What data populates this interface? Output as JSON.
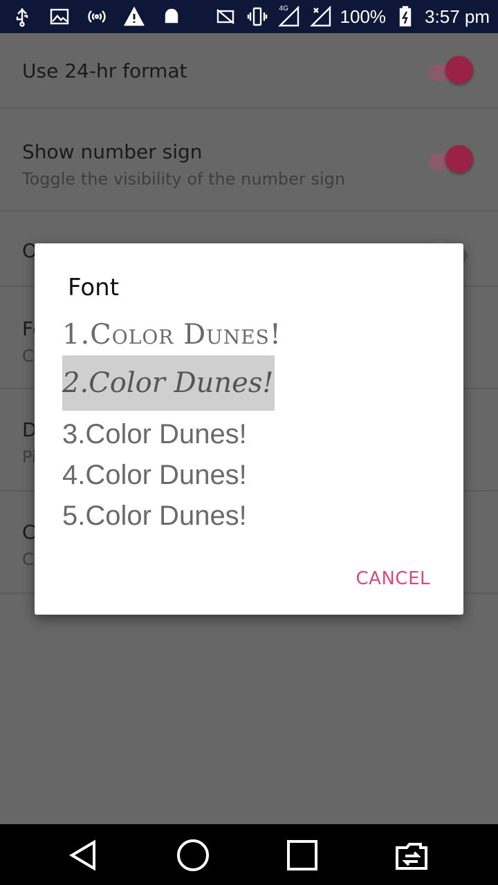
{
  "status_bar": {
    "left_icons": [
      "usb-icon",
      "image-icon",
      "hotspot-icon",
      "warning-icon",
      "android-icon"
    ],
    "right_icons": [
      "no-sim-icon",
      "vibrate-icon",
      "signal-4g-icon",
      "signal-2-icon"
    ],
    "network_label": "4G",
    "battery_percent": "100%",
    "time": "3:57 pm"
  },
  "settings": {
    "rows": [
      {
        "title": "Use 24-hr format",
        "enabled": true
      },
      {
        "title": "Show number sign",
        "subtitle": "Toggle the visibility of the number sign",
        "enabled": true
      },
      {
        "title": "O",
        "enabled": false
      },
      {
        "title": "Fo",
        "subtitle": "C"
      },
      {
        "title": "D",
        "subtitle": "Pi"
      },
      {
        "title": "C",
        "subtitle": "C"
      }
    ]
  },
  "dialog": {
    "title": "Font",
    "options": [
      "1.Color Dunes!",
      "2.Color Dunes!",
      "3.Color Dunes!",
      "4.Color Dunes!",
      "5.Color Dunes!"
    ],
    "selected_index": 1,
    "cancel_label": "CANCEL"
  },
  "nav_bar": {
    "buttons": [
      "back-icon",
      "home-icon",
      "recents-icon",
      "switch-app-icon"
    ]
  },
  "colors": {
    "accent": "#e0467a",
    "toggle_on": "#9a2249",
    "status_bar_bg": "#0f1739",
    "scrim_bg": "#676767"
  }
}
